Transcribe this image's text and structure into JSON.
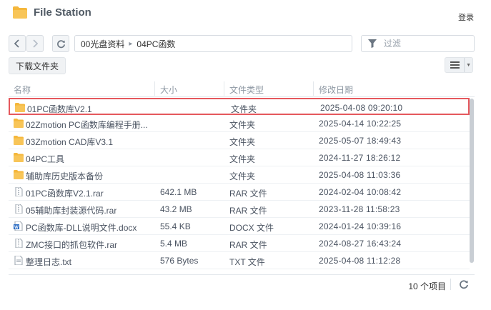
{
  "app": {
    "title": "File Station",
    "login_label": "登录",
    "icon": "folder-icon"
  },
  "toolbar": {
    "back_icon": "chevron-left-icon",
    "forward_icon": "chevron-right-icon",
    "refresh_icon": "refresh-icon",
    "path": [
      "00光盘资料",
      "04PC函数"
    ],
    "filter_placeholder": "过滤",
    "filter_value": ""
  },
  "actions": {
    "create_folder_label": "下载文件夹",
    "view_mode_icon": "list-view-icon"
  },
  "table": {
    "columns": [
      "名称",
      "大小",
      "文件类型",
      "修改日期"
    ],
    "rows": [
      {
        "name": "01PC函数库V2.1",
        "size": "",
        "type": "文件夹",
        "modified": "2025-04-08 09:20:10",
        "icon": "folder-icon",
        "selected": true
      },
      {
        "name": "02Zmotion PC函数库编程手册...",
        "size": "",
        "type": "文件夹",
        "modified": "2025-04-14 10:22:25",
        "icon": "folder-icon",
        "selected": false
      },
      {
        "name": "03Zmotion CAD库V3.1",
        "size": "",
        "type": "文件夹",
        "modified": "2025-05-07 18:49:43",
        "icon": "folder-icon",
        "selected": false
      },
      {
        "name": "04PC工具",
        "size": "",
        "type": "文件夹",
        "modified": "2024-11-27 18:26:12",
        "icon": "folder-icon",
        "selected": false
      },
      {
        "name": "辅助库历史版本备份",
        "size": "",
        "type": "文件夹",
        "modified": "2025-04-08 11:03:36",
        "icon": "folder-icon",
        "selected": false
      },
      {
        "name": "01PC函数库V2.1.rar",
        "size": "642.1 MB",
        "type": "RAR 文件",
        "modified": "2024-02-04 10:08:42",
        "icon": "archive-icon",
        "selected": false
      },
      {
        "name": "05辅助库封装源代码.rar",
        "size": "43.2 MB",
        "type": "RAR 文件",
        "modified": "2023-11-28 11:58:23",
        "icon": "archive-icon",
        "selected": false
      },
      {
        "name": "PC函数库-DLL说明文件.docx",
        "size": "55.4 KB",
        "type": "DOCX 文件",
        "modified": "2024-01-24 10:39:16",
        "icon": "word-doc-icon",
        "selected": false
      },
      {
        "name": "ZMC接口的抓包软件.rar",
        "size": "5.4 MB",
        "type": "RAR 文件",
        "modified": "2024-08-27 16:43:24",
        "icon": "archive-icon",
        "selected": false
      },
      {
        "name": "整理日志.txt",
        "size": "576 Bytes",
        "type": "TXT 文件",
        "modified": "2025-04-08 11:12:28",
        "icon": "text-file-icon",
        "selected": false
      }
    ]
  },
  "footer": {
    "item_count": "10 个项目",
    "refresh_icon": "refresh-icon"
  },
  "colors": {
    "folder": "#f5b73b",
    "selection_border": "#e5585d",
    "word_blue": "#2b6cc4"
  }
}
